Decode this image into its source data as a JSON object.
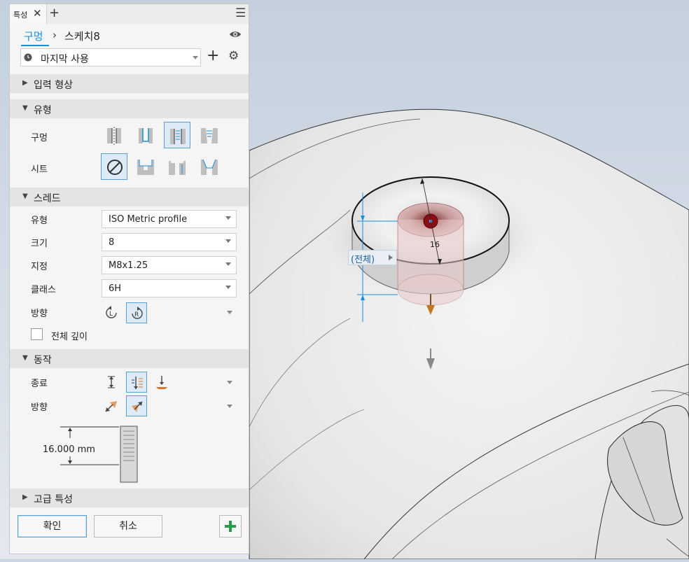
{
  "panel": {
    "tab_title": "특성",
    "breadcrumb": {
      "root": "구멍",
      "current": "스케치8"
    },
    "preset": {
      "value": "마지막 사용"
    },
    "sections": {
      "input": "입력 형상",
      "type": "유형",
      "thread": "스레드",
      "behavior": "동작",
      "advanced": "고급 특성"
    },
    "type_rows": {
      "hole": "구멍",
      "seat": "시트"
    },
    "thread": {
      "type_label": "유형",
      "type_value": "ISO Metric profile",
      "size_label": "크기",
      "size_value": "8",
      "designation_label": "지정",
      "designation_value": "M8x1.25",
      "class_label": "클래스",
      "class_value": "6H",
      "direction_label": "방향",
      "full_depth_label": "전체 깊이"
    },
    "behavior": {
      "termination_label": "종료",
      "direction_label": "방향",
      "depth_value": "16.000 mm"
    },
    "buttons": {
      "ok": "확인",
      "cancel": "취소"
    }
  },
  "viewport": {
    "dimension_label": "16",
    "extent_dropdown": "(전체)"
  },
  "colors": {
    "accent": "#1a8fd9",
    "selection_border": "#5a9fd4",
    "add_green": "#2c9a4a",
    "hole_red": "#7a0d14"
  }
}
